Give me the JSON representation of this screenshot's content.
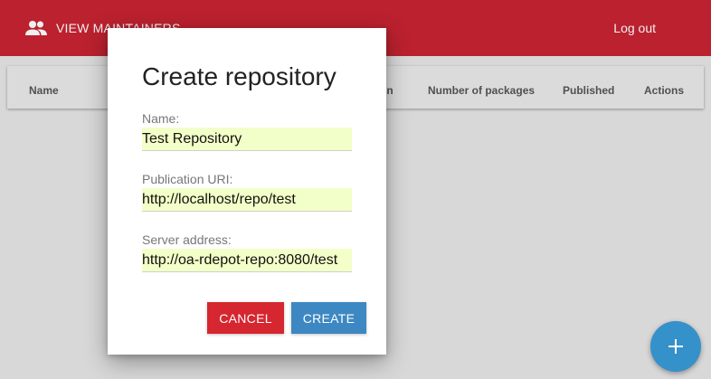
{
  "topbar": {
    "nav_label": "VIEW MAINTAINERS",
    "nav_icon": "people-icon",
    "logout_label": "Log out",
    "color": "#c72432"
  },
  "table": {
    "headers": [
      "Name",
      "Publication",
      "Number of packages",
      "Published",
      "Actions"
    ],
    "header_name": "Name",
    "header_publication_partial": "on",
    "header_packages": "Number of packages",
    "header_published": "Published",
    "header_actions": "Actions"
  },
  "dialog": {
    "title": "Create repository",
    "fields": {
      "name_label": "Name:",
      "name_value": "Test Repository",
      "uri_label": "Publication URI:",
      "uri_value": "http://localhost/repo/test",
      "server_label": "Server address:",
      "server_value": "http://oa-rdepot-repo:8080/test"
    },
    "cancel_label": "CANCEL",
    "create_label": "CREATE"
  },
  "fab": {
    "icon": "plus-icon",
    "color": "#3591c9"
  }
}
